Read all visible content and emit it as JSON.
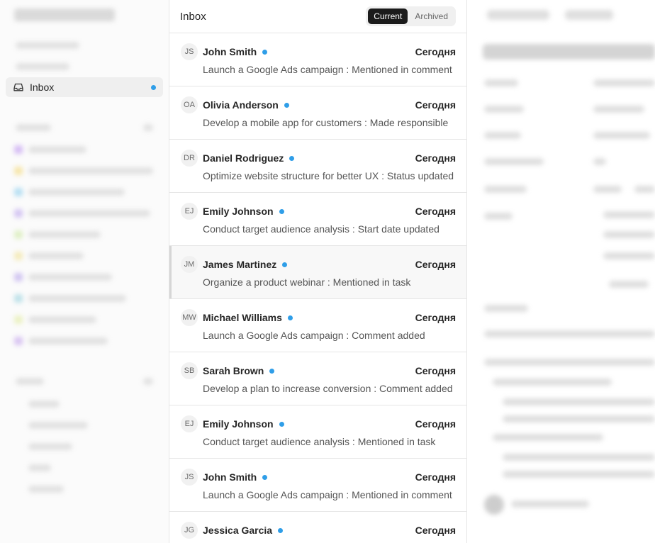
{
  "sidebar": {
    "inbox_label": "Inbox"
  },
  "inbox": {
    "title": "Inbox",
    "tabs": [
      {
        "label": "Current",
        "active": true
      },
      {
        "label": "Archived",
        "active": false
      }
    ],
    "items": [
      {
        "initials": "JS",
        "name": "John Smith",
        "date": "Сегодня",
        "description": "Launch a Google Ads campaign : Mentioned in comment"
      },
      {
        "initials": "OA",
        "name": "Olivia Anderson",
        "date": "Сегодня",
        "description": "Develop a mobile app for customers : Made responsible"
      },
      {
        "initials": "DR",
        "name": "Daniel Rodriguez",
        "date": "Сегодня",
        "description": "Optimize website structure for better UX : Status updated"
      },
      {
        "initials": "EJ",
        "name": "Emily Johnson",
        "date": "Сегодня",
        "description": "Conduct target audience analysis : Start date updated"
      },
      {
        "initials": "JM",
        "name": "James Martinez",
        "date": "Сегодня",
        "description": "Organize a product webinar : Mentioned in task"
      },
      {
        "initials": "MW",
        "name": "Michael Williams",
        "date": "Сегодня",
        "description": "Launch a Google Ads campaign : Comment added"
      },
      {
        "initials": "SB",
        "name": "Sarah Brown",
        "date": "Сегодня",
        "description": "Develop a plan to increase conversion : Comment added"
      },
      {
        "initials": "EJ",
        "name": "Emily Johnson",
        "date": "Сегодня",
        "description": "Conduct target audience analysis : Mentioned in task"
      },
      {
        "initials": "JS",
        "name": "John Smith",
        "date": "Сегодня",
        "description": "Launch a Google Ads campaign : Mentioned in comment"
      },
      {
        "initials": "JG",
        "name": "Jessica Garcia",
        "date": "Сегодня",
        "description": ""
      }
    ]
  },
  "colors": {
    "unread_dot": "#2f9ee8",
    "active_tab_bg": "#1b1b1b",
    "hover_row_bg": "#f8f8f8"
  },
  "icons": {
    "inbox": "inbox-tray-icon",
    "unread": "unread-dot-icon"
  }
}
